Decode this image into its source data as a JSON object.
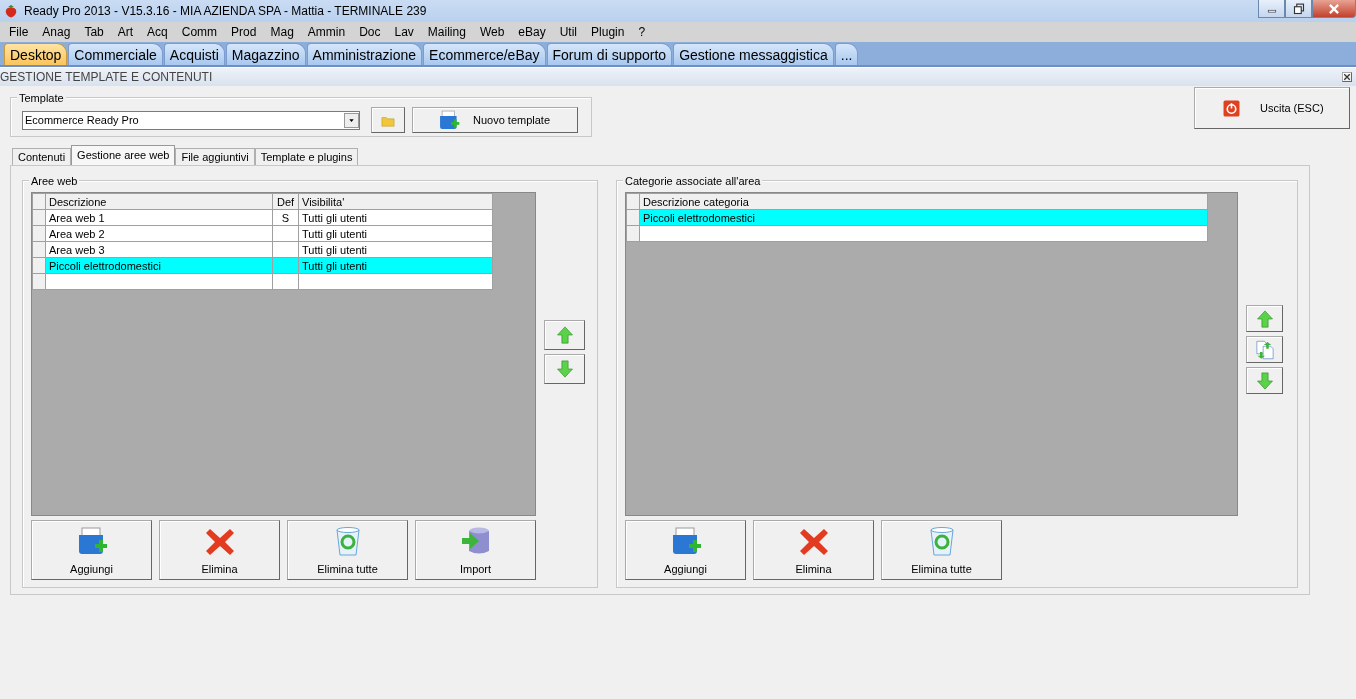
{
  "window": {
    "title": "Ready Pro 2013 - V15.3.16 - MIA AZIENDA SPA - Mattia - TERMINALE 239"
  },
  "menu": [
    "File",
    "Anag",
    "Tab",
    "Art",
    "Acq",
    "Comm",
    "Prod",
    "Mag",
    "Ammin",
    "Doc",
    "Lav",
    "Mailing",
    "Web",
    "eBay",
    "Util",
    "Plugin",
    "?"
  ],
  "module_tabs": [
    {
      "label": "Desktop",
      "selected": true
    },
    {
      "label": "Commerciale",
      "selected": false
    },
    {
      "label": "Acquisti",
      "selected": false
    },
    {
      "label": "Magazzino",
      "selected": false
    },
    {
      "label": "Amministrazione",
      "selected": false
    },
    {
      "label": "Ecommerce/eBay",
      "selected": false
    },
    {
      "label": "Forum di supporto",
      "selected": false
    },
    {
      "label": "Gestione messaggistica",
      "selected": false
    },
    {
      "label": "...",
      "selected": false
    }
  ],
  "section_title": "GESTIONE TEMPLATE E CONTENUTI",
  "template": {
    "legend": "Template",
    "value": "Ecommerce Ready Pro",
    "new_button": "Nuovo template"
  },
  "exit_button": "Uscita (ESC)",
  "tabs": [
    {
      "label": "Contenuti",
      "selected": false
    },
    {
      "label": "Gestione aree web",
      "selected": true
    },
    {
      "label": "File aggiuntivi",
      "selected": false
    },
    {
      "label": "Template e plugins",
      "selected": false
    }
  ],
  "web_areas": {
    "legend": "Aree web",
    "columns": [
      "Descrizione",
      "Def",
      "Visibilita'"
    ],
    "rows": [
      {
        "cells": [
          "Area web 1",
          "S",
          "Tutti gli utenti"
        ],
        "selected": false
      },
      {
        "cells": [
          "Area web 2",
          "",
          "Tutti gli utenti"
        ],
        "selected": false
      },
      {
        "cells": [
          "Area web 3",
          "",
          "Tutti gli utenti"
        ],
        "selected": false
      },
      {
        "cells": [
          "Piccoli elettrodomestici",
          "",
          "Tutti gli utenti"
        ],
        "selected": true
      }
    ],
    "side_buttons": [
      {
        "kind": "up"
      },
      {
        "kind": "down"
      }
    ],
    "buttons": [
      {
        "label": "Aggiungi",
        "kind": "add"
      },
      {
        "label": "Elimina",
        "kind": "delete"
      },
      {
        "label": "Elimina tutte",
        "kind": "trash"
      },
      {
        "label": "Import",
        "kind": "import"
      }
    ]
  },
  "categories": {
    "legend": "Categorie associate all'area",
    "columns": [
      "Descrizione categoria"
    ],
    "rows": [
      {
        "cells": [
          "Piccoli elettrodomestici"
        ],
        "selected": true
      }
    ],
    "side_buttons": [
      {
        "kind": "up"
      },
      {
        "kind": "swap"
      },
      {
        "kind": "down"
      }
    ],
    "buttons": [
      {
        "label": "Aggiungi",
        "kind": "add"
      },
      {
        "label": "Elimina",
        "kind": "delete"
      },
      {
        "label": "Elimina tutte",
        "kind": "trash"
      }
    ]
  }
}
